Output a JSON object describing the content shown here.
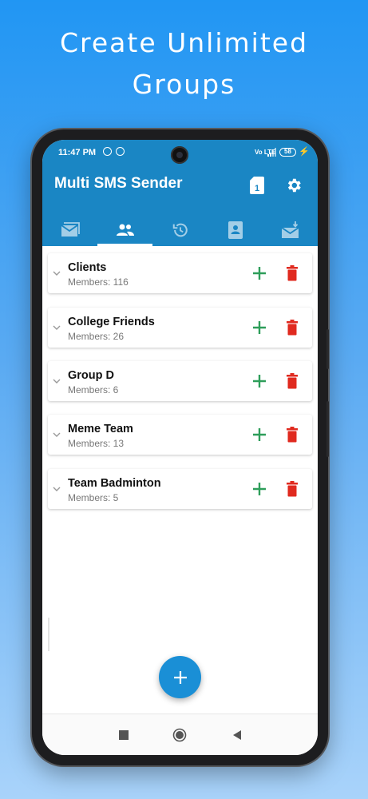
{
  "headline": {
    "line1": "Create Unlimited",
    "line2": "Groups"
  },
  "status_bar": {
    "time": "11:47 PM",
    "network": "Vo LTE",
    "battery": "58"
  },
  "app": {
    "title": "Multi SMS Sender",
    "actions": [
      {
        "icon": "sim-card-icon",
        "label": "SIM 1"
      },
      {
        "icon": "gear-icon",
        "label": "Settings"
      }
    ],
    "tabs": [
      {
        "icon": "message-icon",
        "active": false
      },
      {
        "icon": "groups-icon",
        "active": true
      },
      {
        "icon": "history-icon",
        "active": false
      },
      {
        "icon": "contact-icon",
        "active": false
      },
      {
        "icon": "inbox-icon",
        "active": false
      }
    ],
    "sim_number": "1"
  },
  "groups": [
    {
      "name": "Clients",
      "members": "Members: 116"
    },
    {
      "name": "College Friends",
      "members": "Members: 26"
    },
    {
      "name": "Group D",
      "members": "Members: 6"
    },
    {
      "name": "Meme Team",
      "members": "Members: 13"
    },
    {
      "name": "Team Badminton",
      "members": "Members: 5"
    }
  ],
  "colors": {
    "app_bar": "#1a86c4",
    "add_green": "#2e9e5a",
    "delete_red": "#e02a1f",
    "fab": "#1a8fd6"
  }
}
